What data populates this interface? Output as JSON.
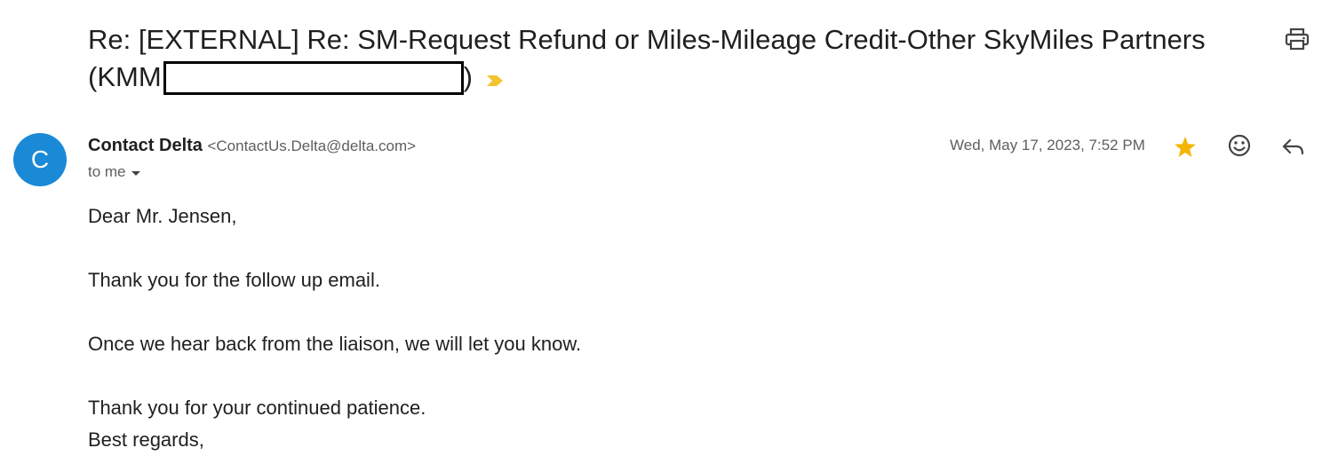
{
  "email": {
    "subject_part1": "Re: [EXTERNAL] Re: SM-Request Refund or Miles-Mileage Credit-Other SkyMiles Partners",
    "subject_part2": "(KMM",
    "subject_part3": ")",
    "redacted": true,
    "important_marker_color": "#f4c430",
    "sender": {
      "avatar_letter": "C",
      "avatar_color": "#1a8ad6",
      "name": "Contact Delta",
      "email": "<ContactUs.Delta@delta.com>",
      "recipient": "to me"
    },
    "timestamp": "Wed, May 17, 2023, 7:52 PM",
    "starred": true,
    "star_color": "#f4b400",
    "body": {
      "greeting": "Dear Mr. Jensen,",
      "line1": "Thank you for the follow up email.",
      "line2": "Once we hear back from the liaison, we will let you know.",
      "line3": "Thank you for your continued patience.",
      "closing": "Best regards,"
    }
  },
  "icons": {
    "print": "print-icon",
    "star": "star-icon",
    "emoji": "emoji-icon",
    "reply": "reply-icon",
    "recipient_details": "caret-down-icon",
    "important": "important-marker-icon"
  }
}
